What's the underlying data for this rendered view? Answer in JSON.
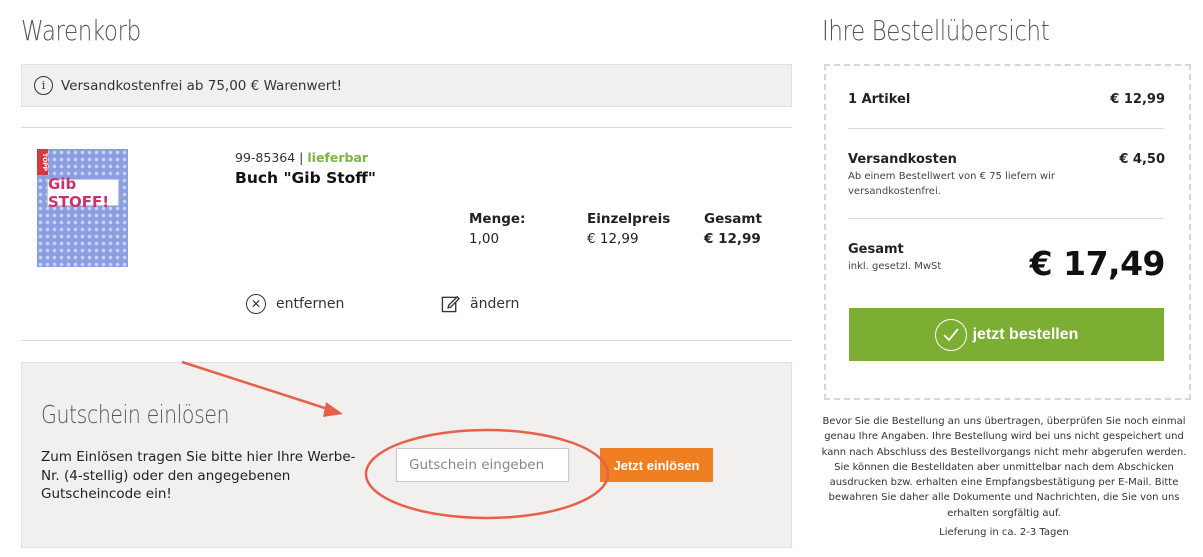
{
  "cart": {
    "title": "Warenkorb",
    "notice": "Versandkostenfrei ab 75,00 € Warenwert!"
  },
  "product": {
    "sku": "99-85364",
    "separator": "|",
    "availability": "lieferbar",
    "name": "Buch \"Gib Stoff\"",
    "image_title": "Gib STOFF!",
    "image_badge": "TOPP",
    "columns": {
      "quantity_label": "Menge:",
      "quantity_value": "1,00",
      "unit_price_label": "Einzelpreis",
      "unit_price_value": "€ 12,99",
      "total_label": "Gesamt",
      "total_value": "€ 12,99"
    },
    "actions": {
      "remove_label": "entfernen",
      "edit_label": "ändern"
    }
  },
  "voucher": {
    "title": "Gutschein einlösen",
    "description": "Zum Einlösen tragen Sie bitte hier Ihre Werbe-Nr. (4-stellig) oder den angegebenen Gutscheincode ein!",
    "input_placeholder": "Gutschein eingeben",
    "button_label": "Jetzt einlösen"
  },
  "summary": {
    "title": "Ihre Bestellübersicht",
    "items_label": "1 Artikel",
    "items_value": "€ 12,99",
    "shipping_label": "Versandkosten",
    "shipping_note": "Ab einem Bestellwert von € 75 liefern wir versandkostenfrei.",
    "shipping_value": "€ 4,50",
    "total_label": "Gesamt",
    "total_note": "inkl. gesetzl. MwSt",
    "total_value": "€ 17,49",
    "order_button_label": "jetzt bestellen",
    "legal_text": "Bevor Sie die Bestellung an uns übertragen, überprüfen Sie noch einmal genau Ihre Angaben. Ihre Bestellung wird bei uns nicht gespeichert und kann nach Abschluss des Bestellvorgangs nicht mehr abgerufen werden. Sie können die Bestelldaten aber unmittelbar nach dem Abschicken ausdrucken bzw. erhalten eine Empfangsbestätigung per E-Mail. Bitte bewahren Sie daher alle Dokumente und Nachrichten, die Sie von uns erhalten sorgfältig auf.",
    "delivery_text": "Lieferung in ca. 2-3 Tagen"
  },
  "colors": {
    "accent_orange": "#f07f22",
    "accent_green": "#7cae34",
    "availability_green": "#7fb444",
    "annotation_red": "#e8604c",
    "panel_bg": "#f1f0ee"
  },
  "icons": [
    "info-icon",
    "remove-icon",
    "edit-icon",
    "check-icon"
  ]
}
